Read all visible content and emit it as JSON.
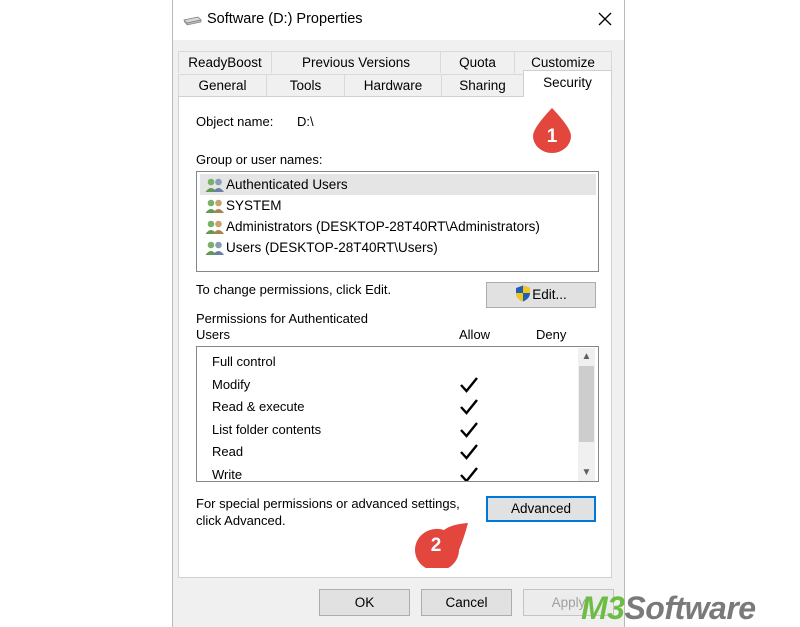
{
  "window": {
    "title": "Software (D:) Properties"
  },
  "tabs_row1": [
    "ReadyBoost",
    "Previous Versions",
    "Quota",
    "Customize"
  ],
  "tabs_row2": [
    "General",
    "Tools",
    "Hardware",
    "Sharing",
    "Security"
  ],
  "active_tab": "Security",
  "object_name": {
    "label": "Object name:",
    "value": "D:\\"
  },
  "group_label": "Group or user names:",
  "users": [
    "Authenticated Users",
    "SYSTEM",
    "Administrators (DESKTOP-28T40RT\\Administrators)",
    "Users (DESKTOP-28T40RT\\Users)"
  ],
  "change_text": "To change permissions, click Edit.",
  "edit_label": "Edit...",
  "perm_header": {
    "line1": "Permissions for Authenticated",
    "line2": "Users",
    "allow": "Allow",
    "deny": "Deny"
  },
  "permissions": [
    {
      "name": "Full control",
      "allow": false
    },
    {
      "name": "Modify",
      "allow": true
    },
    {
      "name": "Read & execute",
      "allow": true
    },
    {
      "name": "List folder contents",
      "allow": true
    },
    {
      "name": "Read",
      "allow": true
    },
    {
      "name": "Write",
      "allow": true
    }
  ],
  "special_text": {
    "line1": "For special permissions or advanced settings,",
    "line2": "click Advanced."
  },
  "advanced_label": "Advanced",
  "footer": {
    "ok": "OK",
    "cancel": "Cancel",
    "apply": "Apply"
  },
  "markers": [
    "1",
    "2"
  ],
  "marker_color": "#e2463d",
  "brand": {
    "m3": "M3",
    "software": "Software",
    "green": "#6dbd45",
    "gray": "#7a7a7a"
  }
}
